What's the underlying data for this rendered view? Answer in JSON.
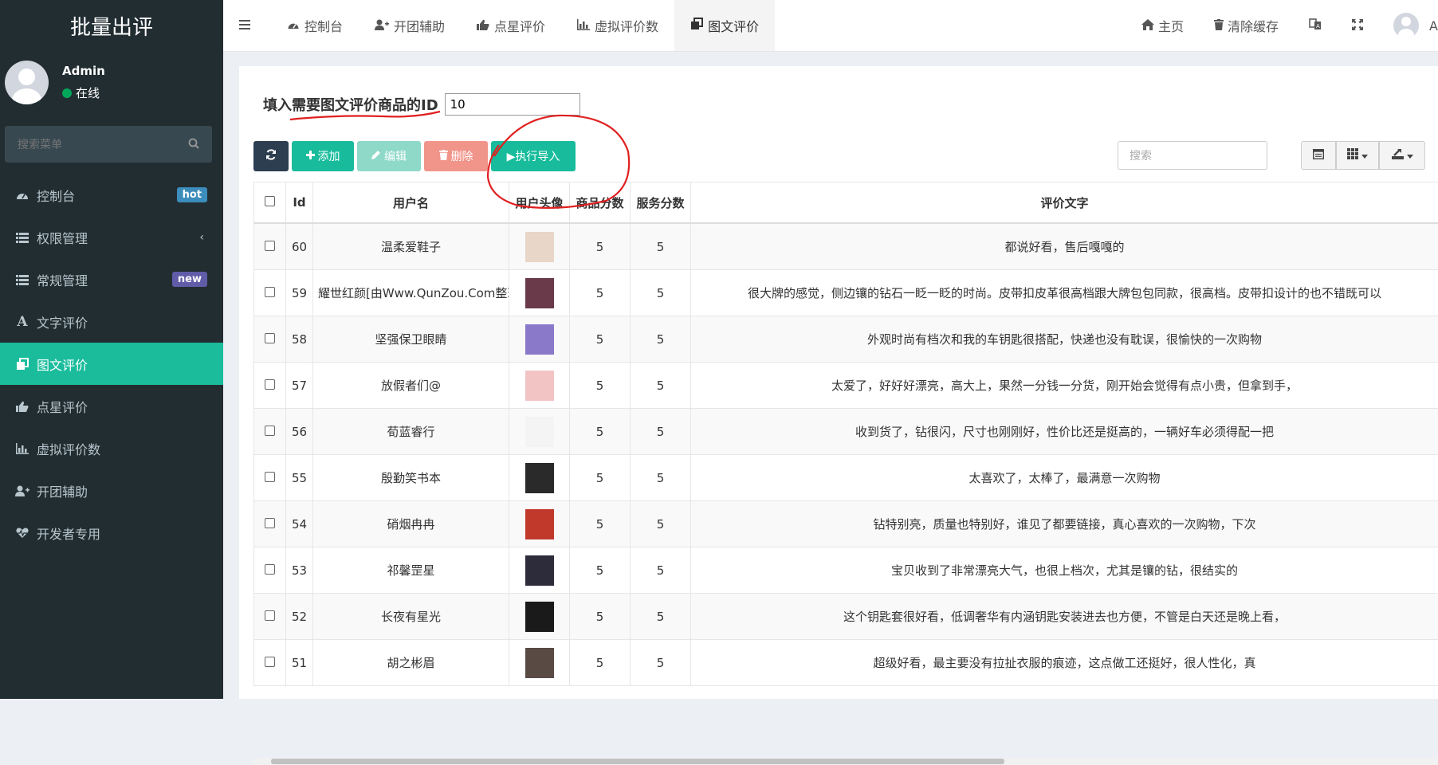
{
  "sidebar": {
    "brand": "批量出评",
    "user": {
      "name": "Admin",
      "status": "在线"
    },
    "search_placeholder": "搜索菜单",
    "items": [
      {
        "label": "控制台",
        "icon": "dashboard-icon",
        "badge": "hot"
      },
      {
        "label": "权限管理",
        "icon": "list-icon",
        "chevron": "‹"
      },
      {
        "label": "常规管理",
        "icon": "list-icon",
        "badge": "new"
      },
      {
        "label": "文字评价",
        "icon": "font-icon"
      },
      {
        "label": "图文评价",
        "icon": "clone-icon",
        "active": true
      },
      {
        "label": "点星评价",
        "icon": "thumbs-up-icon"
      },
      {
        "label": "虚拟评价数",
        "icon": "bar-chart-icon"
      },
      {
        "label": "开团辅助",
        "icon": "user-plus-icon"
      },
      {
        "label": "开发者专用",
        "icon": "heartbeat-icon"
      }
    ]
  },
  "topbar": {
    "tabs": [
      {
        "label": "控制台",
        "icon": "dashboard-icon"
      },
      {
        "label": "开团辅助",
        "icon": "user-plus-icon"
      },
      {
        "label": "点星评价",
        "icon": "thumbs-up-icon"
      },
      {
        "label": "虚拟评价数",
        "icon": "bar-chart-icon"
      },
      {
        "label": "图文评价",
        "icon": "clone-icon",
        "active": true
      }
    ],
    "home": "主页",
    "clear_cache": "清除缓存",
    "user_initial": "A"
  },
  "form": {
    "id_label": "填入需要图文评价商品的ID",
    "id_value": "10"
  },
  "toolbar": {
    "add": "添加",
    "edit": "编辑",
    "delete": "删除",
    "execute": "▶执行导入",
    "search_placeholder": "搜索"
  },
  "table": {
    "headers": [
      "Id",
      "用户名",
      "用户头像",
      "商品分数",
      "服务分数",
      "评价文字"
    ],
    "rows": [
      {
        "id": "60",
        "username": "温柔爱鞋子",
        "goods": "5",
        "service": "5",
        "comment": "都说好看，售后嘎嘎的",
        "avatar_color": "#e8d6c8"
      },
      {
        "id": "59",
        "username": "耀世红颜[由Www.QunZou.Com整理]",
        "goods": "5",
        "service": "5",
        "comment": "很大牌的感觉，侧边镶的钻石一眨一眨的时尚。皮带扣皮革很高档跟大牌包包同款，很高档。皮带扣设计的也不错既可以",
        "avatar_color": "#6a3a4a"
      },
      {
        "id": "58",
        "username": "坚强保卫眼睛",
        "goods": "5",
        "service": "5",
        "comment": "外观时尚有档次和我的车钥匙很搭配，快递也没有耽误，很愉快的一次购物",
        "avatar_color": "#8a78c8"
      },
      {
        "id": "57",
        "username": "放假者们@",
        "goods": "5",
        "service": "5",
        "comment": "太爱了，好好好漂亮，高大上，果然一分钱一分货，刚开始会觉得有点小贵，但拿到手，",
        "avatar_color": "#f3c4c4"
      },
      {
        "id": "56",
        "username": "荀蓝睿行",
        "goods": "5",
        "service": "5",
        "comment": "收到货了，钻很闪，尺寸也刚刚好，性价比还是挺高的，一辆好车必须得配一把",
        "avatar_color": "#f4f4f4"
      },
      {
        "id": "55",
        "username": "殷勤笑书本",
        "goods": "5",
        "service": "5",
        "comment": "太喜欢了，太棒了，最满意一次购物",
        "avatar_color": "#2a2a2a"
      },
      {
        "id": "54",
        "username": "硝烟冉冉",
        "goods": "5",
        "service": "5",
        "comment": "钻特别亮，质量也特别好，谁见了都要链接，真心喜欢的一次购物，下次",
        "avatar_color": "#c0392b"
      },
      {
        "id": "53",
        "username": "祁馨罡星",
        "goods": "5",
        "service": "5",
        "comment": "宝贝收到了非常漂亮大气，也很上档次，尤其是镶的钻，很结实的",
        "avatar_color": "#2c2c3a"
      },
      {
        "id": "52",
        "username": "长夜有星光",
        "goods": "5",
        "service": "5",
        "comment": "这个钥匙套很好看，低调奢华有内涵钥匙安装进去也方便，不管是白天还是晚上看，",
        "avatar_color": "#1a1a1a"
      },
      {
        "id": "51",
        "username": "胡之彬眉",
        "goods": "5",
        "service": "5",
        "comment": "超级好看，最主要没有拉扯衣服的痕迹，这点做工还挺好，很人性化，真",
        "avatar_color": "#5a4a44"
      }
    ]
  },
  "colors": {
    "sidebar_bg": "#222d32",
    "active": "#1abc9c",
    "annotation": "#e02020"
  }
}
